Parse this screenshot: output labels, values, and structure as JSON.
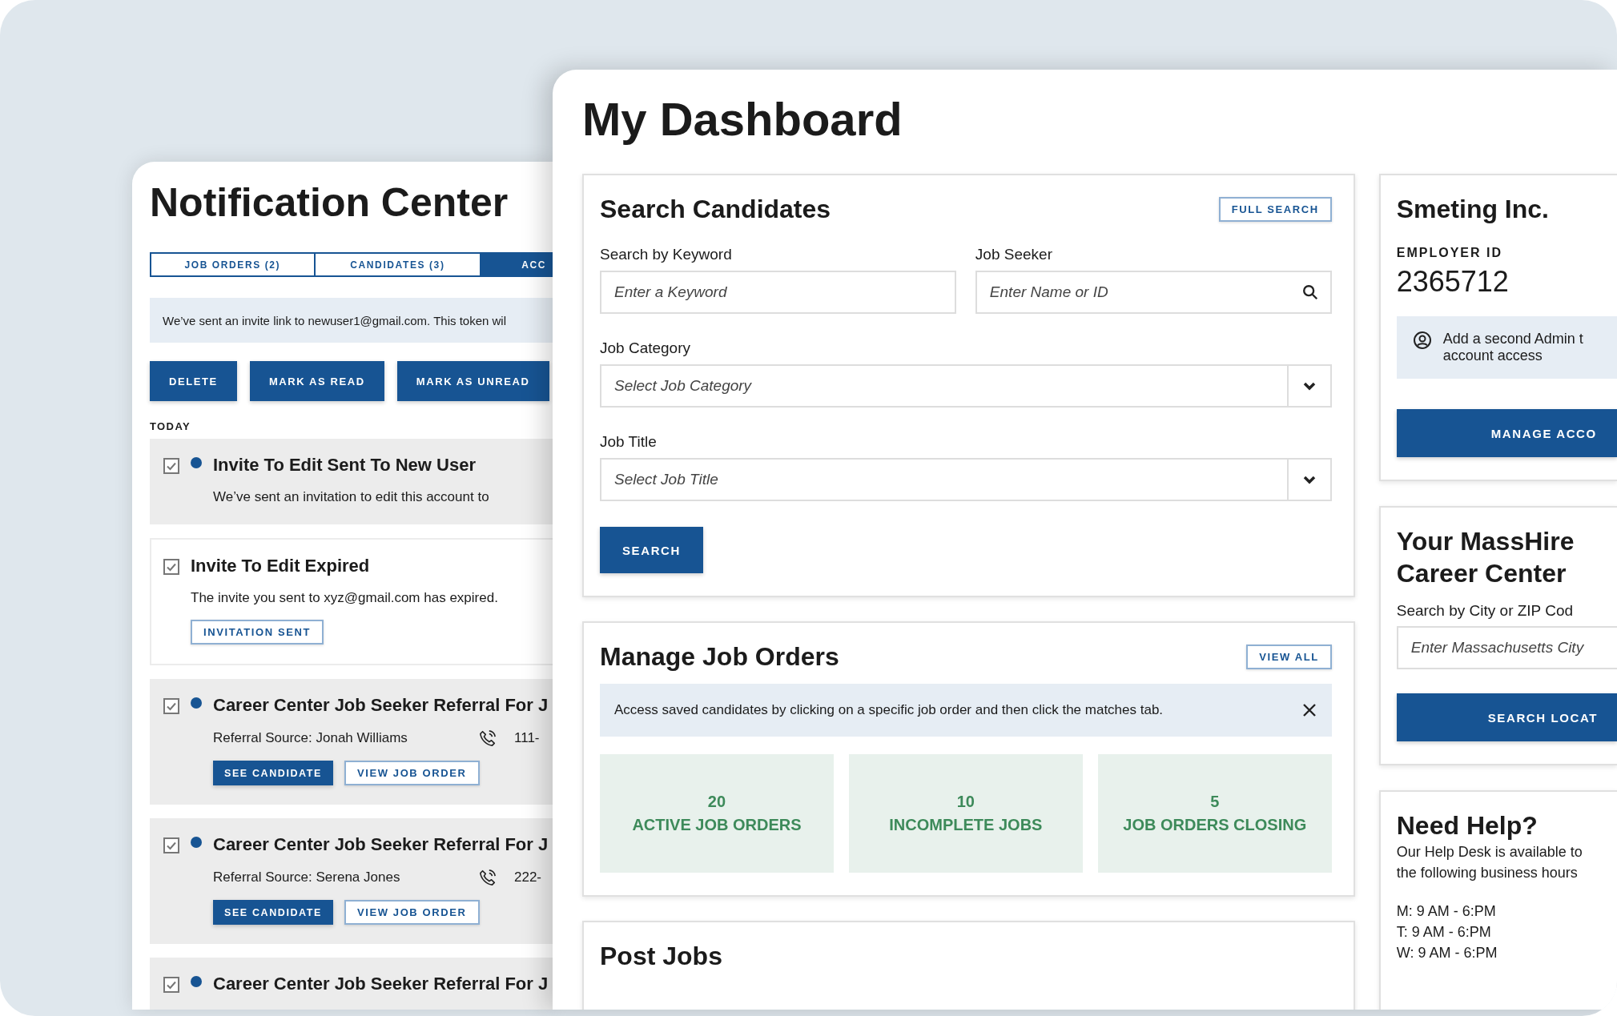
{
  "notification_center": {
    "title": "Notification Center",
    "tabs": [
      {
        "label": "JOB ORDERS (2)",
        "selected": false
      },
      {
        "label": "CANDIDATES (3)",
        "selected": false
      },
      {
        "label": "ACC",
        "selected": true
      }
    ],
    "notice": "We’ve sent an invite link to newuser1@gmail.com. This token wil",
    "actions": [
      "DELETE",
      "MARK AS READ",
      "MARK AS UNREAD"
    ],
    "section_label": "TODAY",
    "items": [
      {
        "kind": "message",
        "checked": true,
        "unread": true,
        "title": "Invite To Edit Sent To New User",
        "body": "We’ve sent an invitation to edit this account to"
      },
      {
        "kind": "expired",
        "checked": true,
        "unread": false,
        "title": "Invite To Edit Expired",
        "body": "The invite you sent to xyz@gmail.com has expired.",
        "badge": "INVITATION SENT"
      },
      {
        "kind": "referral",
        "checked": true,
        "unread": true,
        "title": "Career Center Job Seeker Referral For J",
        "source": "Referral Source: Jonah Williams",
        "phone": "111-",
        "buttons": [
          "SEE CANDIDATE",
          "VIEW JOB ORDER"
        ]
      },
      {
        "kind": "referral",
        "checked": true,
        "unread": true,
        "title": "Career Center Job Seeker Referral For J",
        "source": "Referral Source: Serena Jones",
        "phone": "222-",
        "buttons": [
          "SEE CANDIDATE",
          "VIEW JOB ORDER"
        ]
      },
      {
        "kind": "title",
        "checked": true,
        "unread": true,
        "title": "Career Center Job Seeker Referral For J"
      }
    ]
  },
  "dashboard": {
    "title": "My Dashboard",
    "search_candidates": {
      "title": "Search Candidates",
      "action": "FULL SEARCH",
      "fields": [
        {
          "kind": "text",
          "label": "Search by Keyword",
          "placeholder": "Enter a Keyword"
        },
        {
          "kind": "search",
          "label": "Job Seeker",
          "placeholder": "Enter Name or ID"
        },
        {
          "kind": "select",
          "label": "Job Category",
          "placeholder": "Select Job Category"
        },
        {
          "kind": "select",
          "label": "Job Title",
          "placeholder": "Select Job Title"
        }
      ],
      "button": "SEARCH"
    },
    "manage_job_orders": {
      "title": "Manage Job Orders",
      "action": "VIEW ALL",
      "notice": "Access saved candidates by clicking on a specific job order and then click the matches tab.",
      "stats": [
        {
          "count": "20",
          "label": "ACTIVE JOB ORDERS"
        },
        {
          "count": "10",
          "label": "INCOMPLETE JOBS"
        },
        {
          "count": "5",
          "label": "JOB ORDERS CLOSING"
        }
      ]
    },
    "post_jobs": {
      "title": "Post Jobs"
    },
    "employer": {
      "name": "Smeting Inc.",
      "id_label": "EMPLOYER ID",
      "id": "2365712",
      "notice": [
        "Add a second Admin t",
        "account access"
      ],
      "button": "MANAGE ACCO"
    },
    "career_center": {
      "title": "Your MassHire Career Center",
      "field_label": "Search by City or ZIP Cod",
      "placeholder": "Enter Massachusetts City",
      "button": "SEARCH LOCAT"
    },
    "help": {
      "title": "Need Help?",
      "lines": [
        "Our Help Desk is available to",
        "the following business hours"
      ],
      "hours": [
        "M: 9 AM - 6:PM",
        "T: 9 AM - 6:PM",
        "W: 9 AM - 6:PM"
      ]
    }
  }
}
